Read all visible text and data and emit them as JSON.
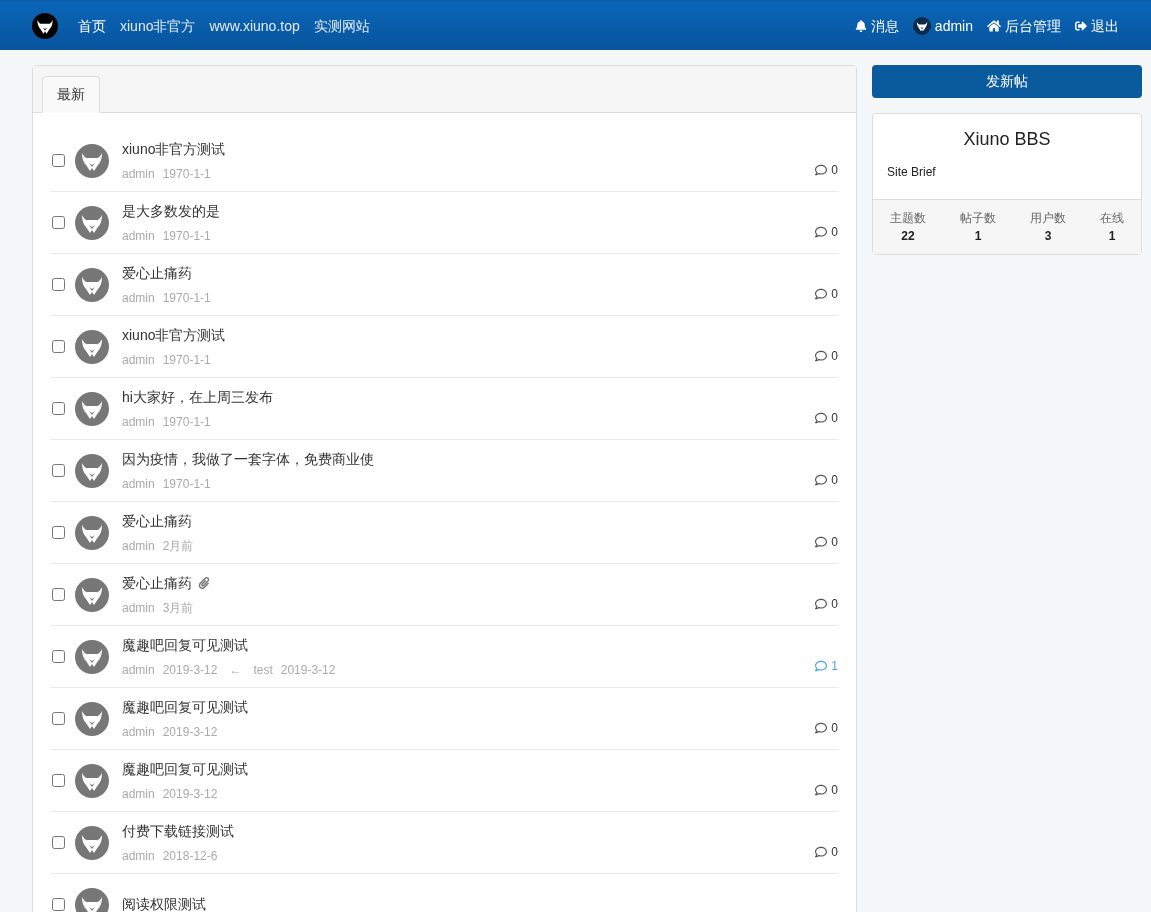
{
  "navbar": {
    "links": [
      "首页",
      "xiuno非官方",
      "www.xiuno.top",
      "实测网站"
    ],
    "right": [
      {
        "kind": "bell",
        "label": "消息"
      },
      {
        "kind": "avatar",
        "label": "admin"
      },
      {
        "kind": "home",
        "label": "后台管理"
      },
      {
        "kind": "logout",
        "label": "退出"
      }
    ]
  },
  "tabs": [
    {
      "label": "最新",
      "selected": true
    }
  ],
  "threads": [
    {
      "title": "xiuno非官方测试",
      "user": "admin",
      "date": "1970-1-1",
      "replies": "0",
      "checked": false
    },
    {
      "title": "是大多数发的是",
      "user": "admin",
      "date": "1970-1-1",
      "replies": "0",
      "checked": false
    },
    {
      "title": "爱心止痛药",
      "user": "admin",
      "date": "1970-1-1",
      "replies": "0",
      "checked": false
    },
    {
      "title": "xiuno非官方测试",
      "user": "admin",
      "date": "1970-1-1",
      "replies": "0",
      "checked": false
    },
    {
      "title": "hi大家好，在上周三发布",
      "user": "admin",
      "date": "1970-1-1",
      "replies": "0",
      "checked": false
    },
    {
      "title": "因为疫情，我做了一套字体，免费商业使",
      "user": "admin",
      "date": "1970-1-1",
      "replies": "0",
      "checked": false
    },
    {
      "title": "爱心止痛药",
      "user": "admin",
      "date": "2月前",
      "replies": "0",
      "checked": false
    },
    {
      "title": "爱心止痛药",
      "user": "admin",
      "date": "3月前",
      "replies": "0",
      "checked": false,
      "attachment": true
    },
    {
      "title": "魔趣吧回复可见测试",
      "user": "admin",
      "date": "2019-3-12",
      "replies": "1",
      "checked": false,
      "last_reply": {
        "arrow": "←",
        "user": "test",
        "date": "2019-3-12"
      }
    },
    {
      "title": "魔趣吧回复可见测试",
      "user": "admin",
      "date": "2019-3-12",
      "replies": "0",
      "checked": false
    },
    {
      "title": "魔趣吧回复可见测试",
      "user": "admin",
      "date": "2019-3-12",
      "replies": "0",
      "checked": false
    },
    {
      "title": "付费下载链接测试",
      "user": "admin",
      "date": "2018-12-6",
      "replies": "0",
      "checked": false
    },
    {
      "title": "阅读权限测试",
      "checked": false
    }
  ],
  "sidebar": {
    "button": "发新帖",
    "site_name": "Xiuno BBS",
    "brief": "Site Brief",
    "stats": [
      {
        "label": "主题数",
        "value": "22"
      },
      {
        "label": "帖子数",
        "value": "1"
      },
      {
        "label": "用户数",
        "value": "3"
      },
      {
        "label": "在线",
        "value": "1"
      }
    ]
  }
}
